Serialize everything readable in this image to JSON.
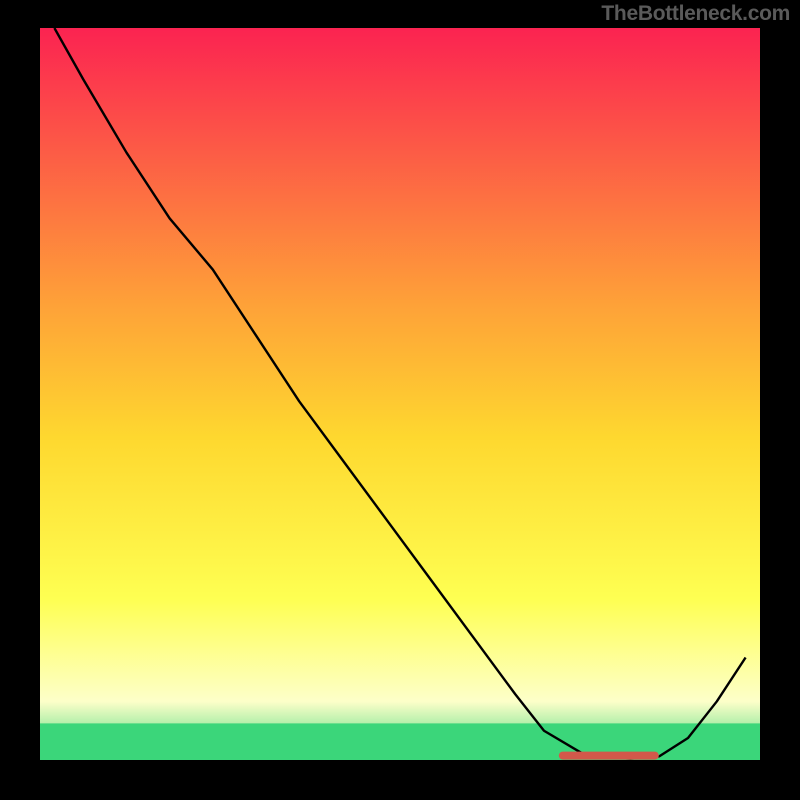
{
  "watermark": "TheBottleneck.com",
  "chart_data": {
    "type": "line",
    "title": "",
    "xlabel": "",
    "ylabel": "",
    "xlim": [
      0,
      100
    ],
    "ylim": [
      0,
      100
    ],
    "grid": false,
    "series": [
      {
        "name": "curve",
        "color": "#000000",
        "x": [
          2,
          6,
          12,
          18,
          24,
          30,
          36,
          42,
          48,
          54,
          60,
          66,
          70,
          76,
          82,
          86,
          90,
          94,
          98
        ],
        "y": [
          100,
          93,
          83,
          74,
          67,
          58,
          49,
          41,
          33,
          25,
          17,
          9,
          4,
          0.5,
          0.2,
          0.5,
          3,
          8,
          14
        ]
      }
    ],
    "highlight_band": {
      "name": "green-band",
      "y_from": 0,
      "y_to": 5,
      "color": "#3bd67a"
    },
    "marker": {
      "name": "red-marker",
      "x": 79,
      "y": 0.6,
      "color": "#d3584a"
    },
    "background_gradient": {
      "top": "#fb2351",
      "mid_upper": "#fea238",
      "mid": "#fed82f",
      "mid_lower": "#feff52",
      "pale": "#fdffc9",
      "bottom": "#3bd67a"
    }
  }
}
